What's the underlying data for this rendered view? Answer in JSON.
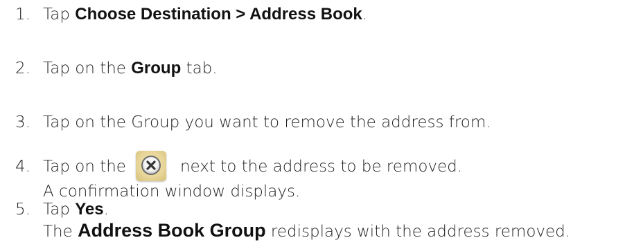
{
  "steps": [
    {
      "number": "1.",
      "parts": [
        "Tap ",
        "Choose Destination > Address Book",
        "."
      ]
    },
    {
      "number": "2.",
      "parts": [
        "Tap on the ",
        "Group",
        " tab."
      ]
    },
    {
      "number": "3.",
      "text": "Tap on the Group you want to remove the address from."
    },
    {
      "number": "4.",
      "parts": [
        "Tap on the",
        "next to the address to be removed."
      ],
      "icon": "close-x-icon",
      "sub": "A confirmation window displays."
    },
    {
      "number": "5.",
      "parts": [
        "Tap ",
        "Yes",
        "."
      ],
      "sub_parts": [
        "The ",
        "Address Book Group",
        " redisplays with the address removed."
      ]
    }
  ],
  "colors": {
    "text": "#222222",
    "icon_bg": "#e8d69a",
    "icon_x": "#333333"
  }
}
